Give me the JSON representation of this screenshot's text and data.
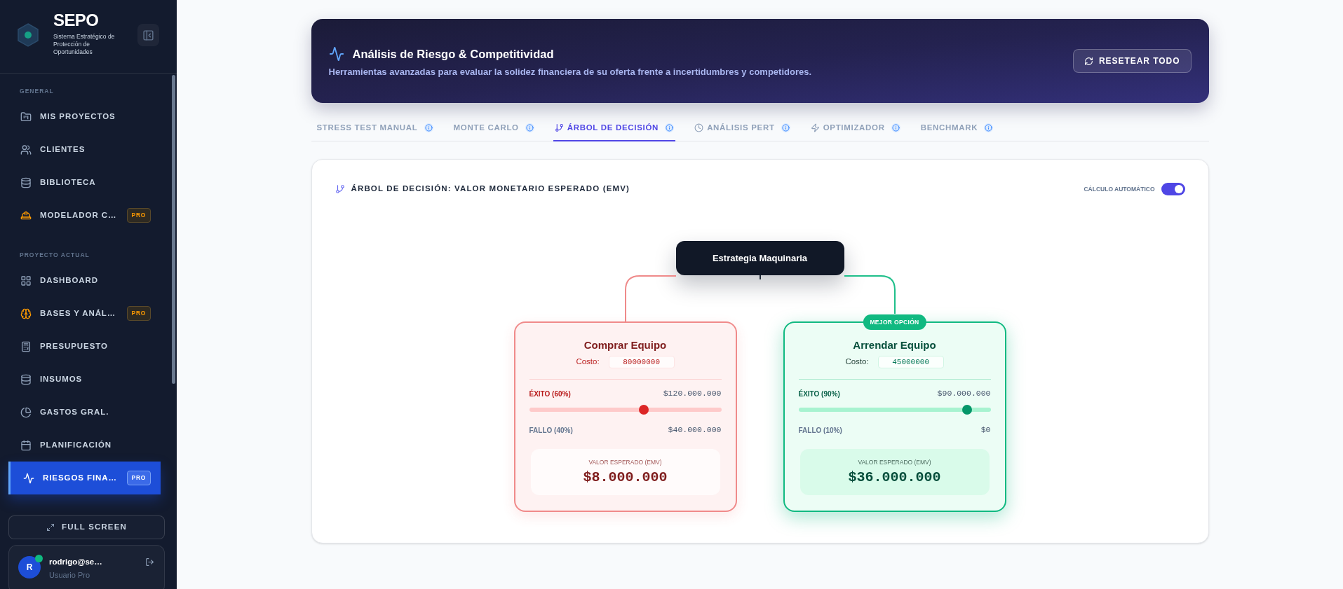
{
  "sidebar": {
    "brand": {
      "name": "SEPO",
      "subtitle": "Sistema Estratégico de Protección de Oportunidades"
    },
    "sections": [
      {
        "heading": "GENERAL",
        "items": [
          {
            "label": "MIS PROYECTOS",
            "selected": false
          },
          {
            "label": "CLIENTES",
            "selected": false
          },
          {
            "label": "BIBLIOTECA",
            "selected": false
          },
          {
            "label": "MODELADOR C…",
            "badge": "PRO",
            "selected": false
          }
        ]
      },
      {
        "heading": "PROYECTO ACTUAL",
        "items": [
          {
            "label": "DASHBOARD",
            "selected": false
          },
          {
            "label": "BASES Y ANÁL…",
            "badge": "PRO",
            "selected": false
          },
          {
            "label": "PRESUPUESTO",
            "selected": false
          },
          {
            "label": "INSUMOS",
            "selected": false
          },
          {
            "label": "GASTOS GRAL.",
            "selected": false
          },
          {
            "label": "PLANIFICACIÓN",
            "selected": false
          },
          {
            "label": "RIESGOS FINA…",
            "badge": "PRO",
            "selected": true
          }
        ]
      }
    ],
    "fullscreen_button": "FULL SCREEN",
    "user": {
      "initial": "R",
      "email": "rodrigo@se…",
      "role": "Usuario Pro",
      "online": true
    }
  },
  "header": {
    "title": "Análisis de Riesgo & Competitividad",
    "subtitle": "Herramientas avanzadas para evaluar la solidez financiera de su oferta frente a incertidumbres y competidores.",
    "reset_button": "RESETEAR TODO"
  },
  "tabs": [
    {
      "label": "STRESS TEST MANUAL",
      "selected": false
    },
    {
      "label": "MONTE CARLO",
      "selected": false
    },
    {
      "label": "ÁRBOL DE DECISIÓN",
      "selected": true
    },
    {
      "label": "ANÁLISIS PERT",
      "selected": false
    },
    {
      "label": "OPTIMIZADOR",
      "selected": false
    },
    {
      "label": "BENCHMARK",
      "selected": false
    }
  ],
  "panel": {
    "title": "ÁRBOL DE DECISIÓN: VALOR MONETARIO ESPERADO (EMV)",
    "auto_calc": {
      "label": "CÁLCULO AUTOMÁTICO",
      "on": true
    },
    "tree": {
      "root": "Estrategia Maquinaria",
      "options": [
        {
          "title": "Comprar Equipo",
          "best": false,
          "cost_label": "Costo:",
          "cost": "80000000",
          "success_label": "ÉXITO (60%)",
          "success_value": "$120.000.000",
          "level": 0.6,
          "failure_label": "FALLO (40%)",
          "failure_value": "$40.000.000",
          "emv_label": "VALOR ESPERADO (EMV)",
          "emv": "$8.000.000"
        },
        {
          "title": "Arrendar Equipo",
          "best": true,
          "badge": "MEJOR OPCIÓN",
          "cost_label": "Costo:",
          "cost": "45000000",
          "success_label": "ÉXITO (90%)",
          "success_value": "$90.000.000",
          "level": 0.9,
          "failure_label": "FALLO (10%)",
          "failure_value": "$0",
          "emv_label": "VALOR ESPERADO (EMV)",
          "emv": "$36.000.000"
        }
      ]
    }
  }
}
